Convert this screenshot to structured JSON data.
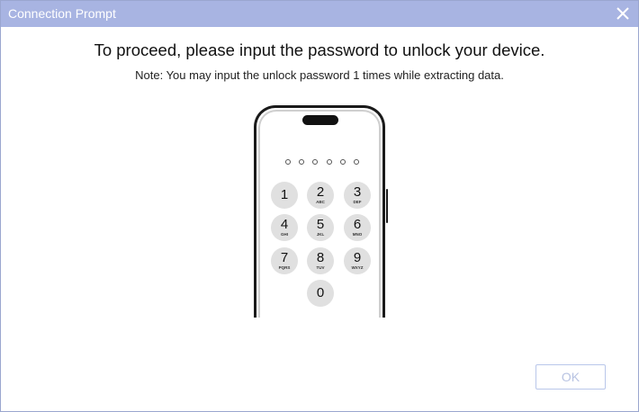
{
  "window": {
    "title": "Connection Prompt",
    "close_icon": "close-icon"
  },
  "message": {
    "heading": "To proceed, please input the password to unlock your device.",
    "note": "Note: You may input the unlock password 1 times while extracting data."
  },
  "phone": {
    "passcode_length": 6,
    "keys": [
      {
        "num": "1",
        "letters": ""
      },
      {
        "num": "2",
        "letters": "ABC"
      },
      {
        "num": "3",
        "letters": "DEF"
      },
      {
        "num": "4",
        "letters": "GHI"
      },
      {
        "num": "5",
        "letters": "JKL"
      },
      {
        "num": "6",
        "letters": "MNO"
      },
      {
        "num": "7",
        "letters": "PQRS"
      },
      {
        "num": "8",
        "letters": "TUV"
      },
      {
        "num": "9",
        "letters": "WXYZ"
      },
      {
        "num": "0",
        "letters": ""
      }
    ]
  },
  "buttons": {
    "ok_label": "OK"
  },
  "colors": {
    "titlebar": "#a8b4e2",
    "ok_text": "#b8c3e2",
    "key_bg": "#e0e0e0"
  }
}
